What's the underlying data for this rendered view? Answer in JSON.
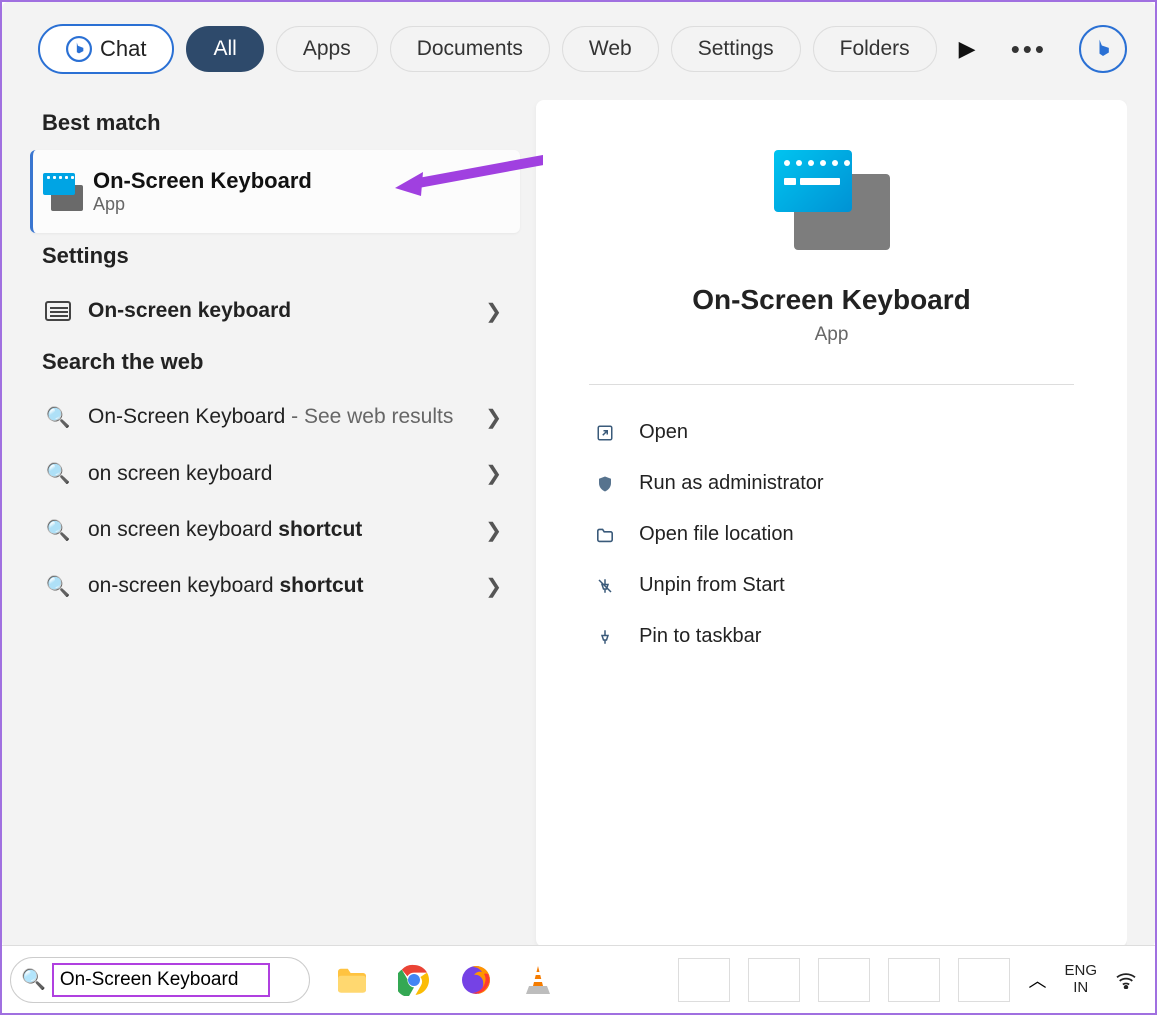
{
  "chat_label": "Chat",
  "tabs": {
    "all": "All",
    "apps": "Apps",
    "documents": "Documents",
    "web": "Web",
    "settings": "Settings",
    "folders": "Folders"
  },
  "sections": {
    "best": "Best match",
    "settings": "Settings",
    "web": "Search the web"
  },
  "best_match": {
    "title": "On-Screen Keyboard",
    "sub": "App"
  },
  "settings_item": "On-screen keyboard",
  "web_items": {
    "w0_main": "On-Screen Keyboard",
    "w0_muted": " - See web results",
    "w1": "on screen keyboard",
    "w2_a": "on screen keyboard ",
    "w2_b": "shortcut",
    "w3_a": "on-screen keyboard ",
    "w3_b": "shortcut"
  },
  "preview": {
    "title": "On-Screen Keyboard",
    "sub": "App"
  },
  "actions": {
    "open": "Open",
    "admin": "Run as administrator",
    "loc": "Open file location",
    "unpin": "Unpin from Start",
    "pin": "Pin to taskbar"
  },
  "taskbar": {
    "search_value": "On-Screen Keyboard",
    "lang1": "ENG",
    "lang2": "IN"
  }
}
